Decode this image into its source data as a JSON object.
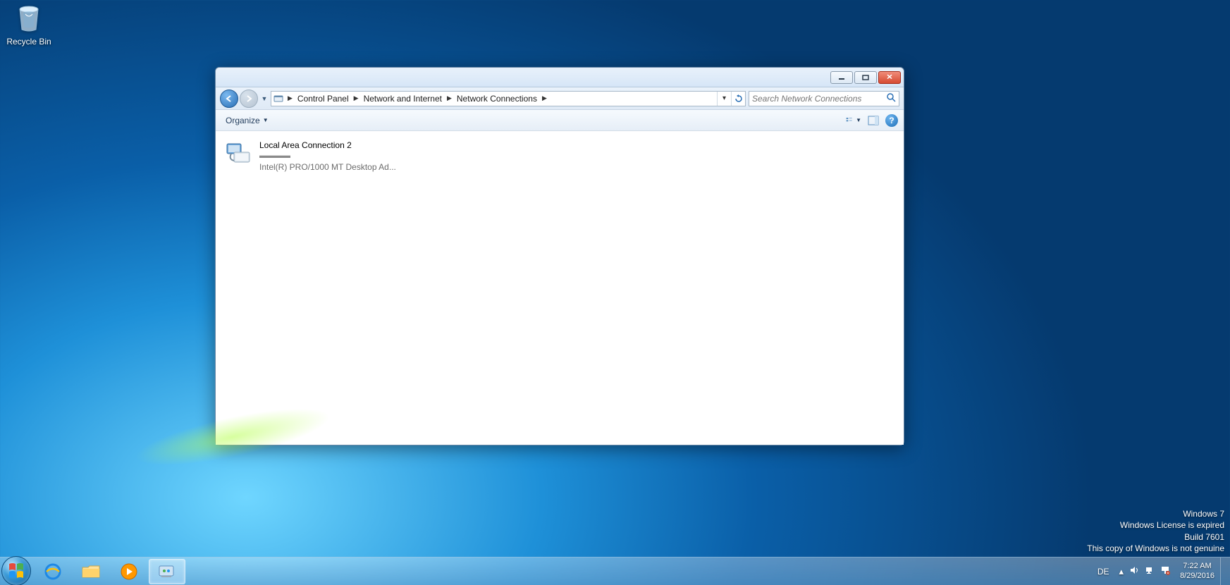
{
  "desktop": {
    "recycle_bin_label": "Recycle Bin"
  },
  "window": {
    "breadcrumbs": {
      "level1": "Control Panel",
      "level2": "Network and Internet",
      "level3": "Network Connections"
    },
    "search_placeholder": "Search Network Connections",
    "toolbar": {
      "organize_label": "Organize"
    },
    "content": {
      "connection": {
        "name": "Local Area Connection 2",
        "status": "",
        "adapter": "Intel(R) PRO/1000 MT Desktop Ad..."
      }
    }
  },
  "watermark": {
    "line1": "Windows 7",
    "line2": "Windows License is expired",
    "line3": "Build 7601",
    "line4": "This copy of Windows is not genuine"
  },
  "taskbar": {
    "lang": "DE",
    "time": "7:22 AM",
    "date": "8/29/2016"
  }
}
